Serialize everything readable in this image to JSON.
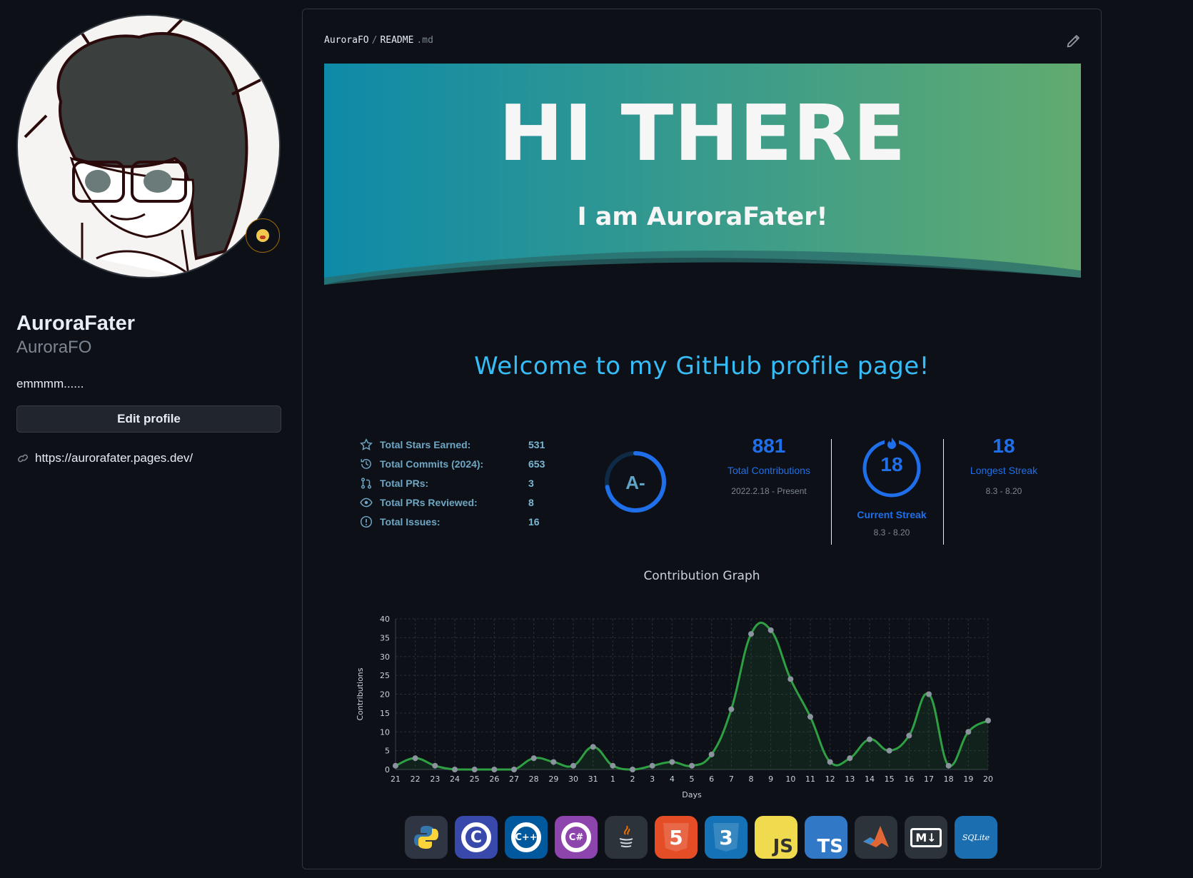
{
  "profile": {
    "display_name": "AuroraFater",
    "login": "AuroraFO",
    "bio": "emmmm......",
    "edit_label": "Edit profile",
    "website": "https://aurorafater.pages.dev/"
  },
  "readme": {
    "owner": "AuroraFO",
    "separator": "/",
    "file_name": "README",
    "file_ext": ".md",
    "banner_title": "HI THERE",
    "banner_subtitle": "I am AuroraFater!",
    "welcome": "Welcome to my GitHub profile page!"
  },
  "stats": {
    "items": [
      {
        "label": "Total Stars Earned:",
        "value": "531",
        "icon": "star-icon"
      },
      {
        "label": "Total Commits (2024):",
        "value": "653",
        "icon": "history-icon"
      },
      {
        "label": "Total PRs:",
        "value": "3",
        "icon": "pull-request-icon"
      },
      {
        "label": "Total PRs Reviewed:",
        "value": "8",
        "icon": "eye-icon"
      },
      {
        "label": "Total Issues:",
        "value": "16",
        "icon": "issue-icon"
      }
    ],
    "rank": "A-",
    "rank_progress": 0.72
  },
  "streak": {
    "total": "881",
    "total_label": "Total Contributions",
    "total_range": "2022.2.18 - Present",
    "current": "18",
    "current_label": "Current Streak",
    "current_range": "8.3 - 8.20",
    "longest": "18",
    "longest_label": "Longest Streak",
    "longest_range": "8.3 - 8.20"
  },
  "chart_data": {
    "type": "line",
    "title": "Contribution Graph",
    "xlabel": "Days",
    "ylabel": "Contributions",
    "ylim": [
      0,
      40
    ],
    "yticks": [
      0,
      5,
      10,
      15,
      20,
      25,
      30,
      35,
      40
    ],
    "grid": true,
    "x": [
      "21",
      "22",
      "23",
      "24",
      "25",
      "26",
      "27",
      "28",
      "29",
      "30",
      "31",
      "1",
      "2",
      "3",
      "4",
      "5",
      "6",
      "7",
      "8",
      "9",
      "10",
      "11",
      "12",
      "13",
      "14",
      "15",
      "16",
      "17",
      "18",
      "19",
      "20"
    ],
    "series": [
      {
        "values": [
          1,
          3,
          1,
          0,
          0,
          0,
          0,
          3,
          2,
          1,
          6,
          1,
          0,
          1,
          2,
          1,
          4,
          16,
          36,
          37,
          24,
          14,
          2,
          3,
          8,
          5,
          9,
          20,
          1,
          10,
          13
        ]
      }
    ]
  },
  "tech_icons": [
    {
      "name": "python-icon",
      "bg": "#2f3542",
      "text": ""
    },
    {
      "name": "c-icon",
      "bg": "#3949ab",
      "text": "C"
    },
    {
      "name": "cpp-icon",
      "bg": "#00599c",
      "text": "C++"
    },
    {
      "name": "csharp-icon",
      "bg": "#8e44ad",
      "text": "C#"
    },
    {
      "name": "java-icon",
      "bg": "#2d333b",
      "text": ""
    },
    {
      "name": "html5-icon",
      "bg": "#e44d26",
      "text": "5"
    },
    {
      "name": "css3-icon",
      "bg": "#1572b6",
      "text": "3"
    },
    {
      "name": "javascript-icon",
      "bg": "#f0db4f",
      "text": "JS"
    },
    {
      "name": "typescript-icon",
      "bg": "#3178c6",
      "text": "TS"
    },
    {
      "name": "matlab-icon",
      "bg": "#2d333b",
      "text": ""
    },
    {
      "name": "markdown-icon",
      "bg": "#2d333b",
      "text": "M↓"
    },
    {
      "name": "sqlite-icon",
      "bg": "#1b6fb1",
      "text": "SQLite"
    }
  ],
  "colors": {
    "accent_blue": "#1f6feb",
    "welcome": "#36bcf7",
    "graph_line": "#2ea043",
    "banner_left": "#0e8aa8",
    "banner_right": "#62ab70"
  }
}
